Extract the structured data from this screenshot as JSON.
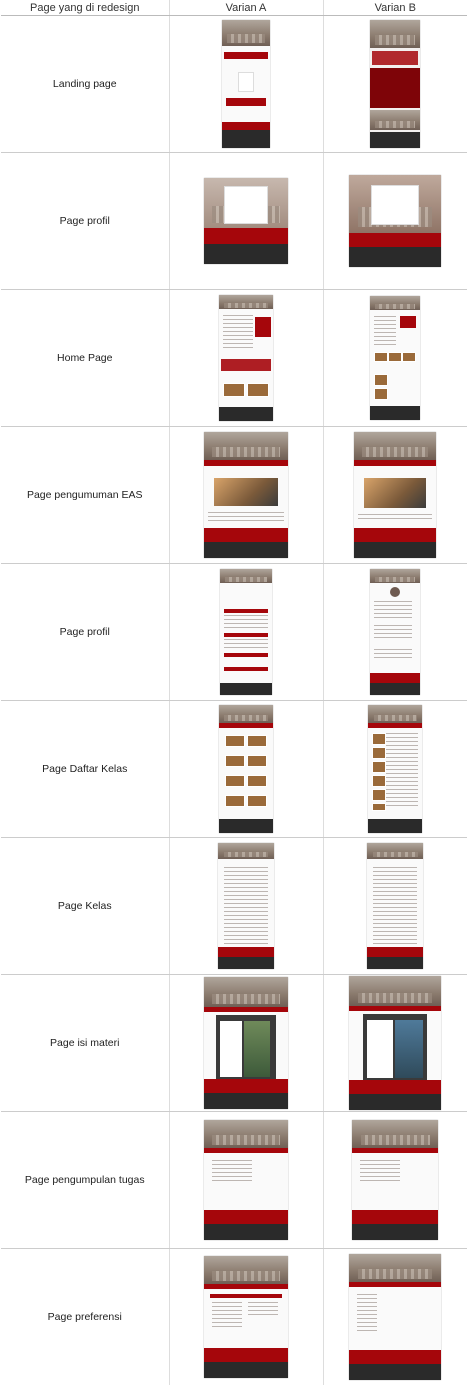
{
  "header": {
    "col1": "Page yang di redesign",
    "col2": "Varian A",
    "col3": "Varian B"
  },
  "rows": [
    {
      "label": "Landing page"
    },
    {
      "label": "Page profil"
    },
    {
      "label": "Home Page"
    },
    {
      "label": "Page pengumuman EAS"
    },
    {
      "label": "Page profil"
    },
    {
      "label": "Page Daftar Kelas"
    },
    {
      "label": "Page Kelas"
    },
    {
      "label": "Page isi materi"
    },
    {
      "label": "Page pengumpulan tugas"
    },
    {
      "label": "Page preferensi"
    }
  ],
  "colors": {
    "brand_red": "#a5060b",
    "footer_dark": "#2a2a2a"
  }
}
